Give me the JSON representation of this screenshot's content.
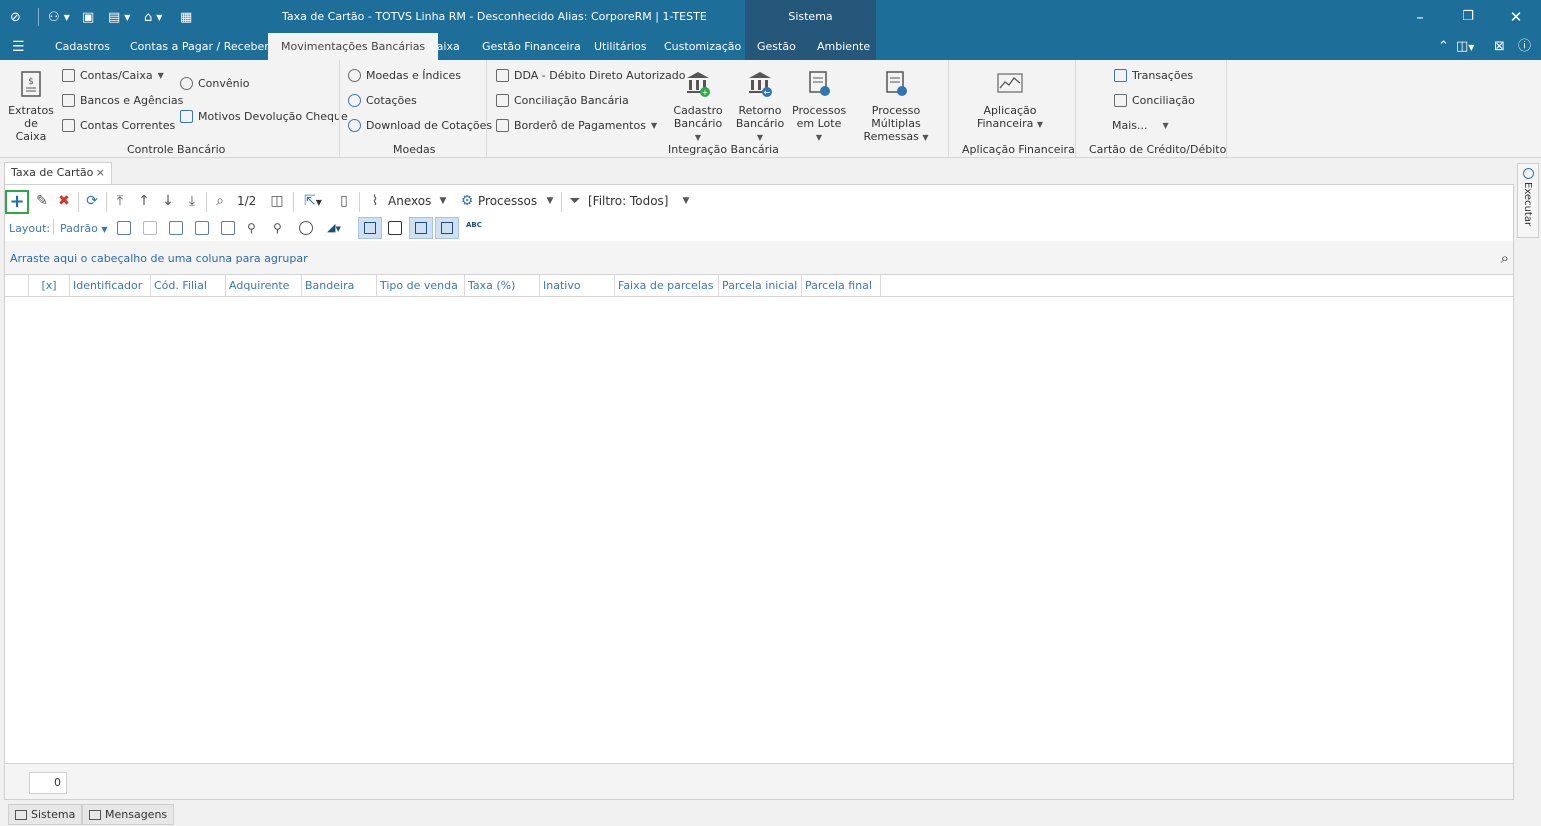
{
  "window": {
    "title": "Taxa de Cartão - TOTVS Linha RM - Desconhecido  Alias: CorporeRM | 1-TESTE",
    "context_tab": "Sistema"
  },
  "menu": {
    "items": [
      "Cadastros",
      "Contas a Pagar / Receber",
      "Movimentações Bancárias",
      "Caixa",
      "Gestão Financeira",
      "Utilitários",
      "Customização",
      "Gestão",
      "Ambiente"
    ],
    "active": "Movimentações Bancárias"
  },
  "ribbon": {
    "controle_bancario": {
      "label": "Controle Bancário",
      "extratos_line1": "Extratos",
      "extratos_line2": "de Caixa",
      "contas_caixa": "Contas/Caixa",
      "bancos_agencias": "Bancos e Agências",
      "contas_correntes": "Contas Correntes",
      "convenio": "Convênio",
      "motivos_devolucao": "Motivos Devolução Cheque"
    },
    "moedas": {
      "label": "Moedas",
      "moedas_indices": "Moedas e Índices",
      "cotacoes": "Cotações",
      "download_cotacoes": "Download de Cotações"
    },
    "integracao": {
      "label": "Integração Bancária",
      "dda": "DDA - Débito Direto Autorizado",
      "conciliacao": "Conciliação Bancária",
      "bordero": "Borderô de Pagamentos",
      "cadastro_line1": "Cadastro",
      "cadastro_line2": "Bancário",
      "retorno_line1": "Retorno",
      "retorno_line2": "Bancário",
      "processos_line1": "Processos",
      "processos_line2": "em Lote",
      "multiplas_line1": "Processo Múltiplas",
      "multiplas_line2": "Remessas"
    },
    "aplicacao": {
      "label": "Aplicação Financeira",
      "btn_line1": "Aplicação",
      "btn_line2": "Financeira"
    },
    "cartao": {
      "label": "Cartão de Crédito/Débito",
      "transacoes": "Transações",
      "conciliacao": "Conciliação",
      "mais": "Mais..."
    }
  },
  "document_tab": {
    "label": "Taxa de Cartão",
    "close": "×"
  },
  "toolbar": {
    "page": "1/2",
    "anexos": "Anexos",
    "processos": "Processos",
    "filtro": "[Filtro: Todos]"
  },
  "layout_bar": {
    "label": "Layout:",
    "value": "Padrão"
  },
  "group_hint": "Arraste aqui o cabeçalho de uma coluna para agrupar",
  "grid": {
    "columns": [
      "[x]",
      "Identificador",
      "Cód. Filial",
      "Adquirente",
      "Bandeira",
      "Tipo de venda",
      "Taxa (%)",
      "Inativo",
      "Faixa de parcelas",
      "Parcela inicial",
      "Parcela final"
    ],
    "rows": []
  },
  "footer": {
    "record_count": "0"
  },
  "side_panel": {
    "label": "Executar"
  },
  "statusbar": {
    "sistema": "Sistema",
    "mensagens": "Mensagens"
  },
  "colors": {
    "titlebar": "#1e6e9a",
    "context_tab": "#25577a",
    "accent_blue": "#3b78b0",
    "new_button_border": "#2aa84a",
    "delete_red": "#d9342b"
  }
}
